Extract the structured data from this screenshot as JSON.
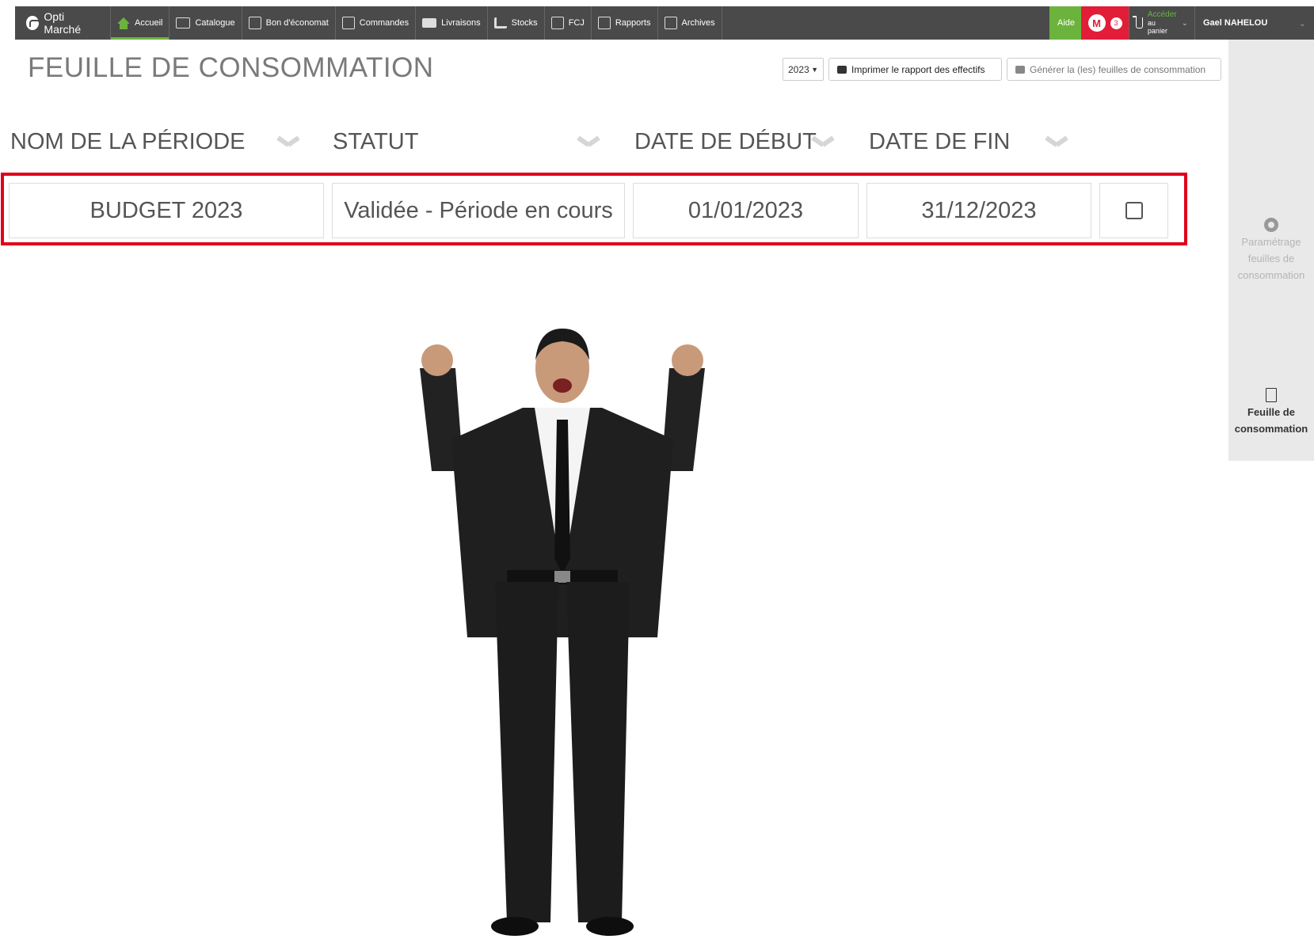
{
  "brand": "Opti Marché",
  "nav": [
    {
      "label": "Accueil",
      "icon": "home-icon",
      "active": true
    },
    {
      "label": "Catalogue",
      "icon": "book-icon"
    },
    {
      "label": "Bon d'économat",
      "icon": "document-icon"
    },
    {
      "label": "Commandes",
      "icon": "clipboard-icon"
    },
    {
      "label": "Livraisons",
      "icon": "truck-icon"
    },
    {
      "label": "Stocks",
      "icon": "forklift-icon"
    },
    {
      "label": "FCJ",
      "icon": "report-icon"
    },
    {
      "label": "Rapports",
      "icon": "chart-icon"
    },
    {
      "label": "Archives",
      "icon": "archive-icon"
    }
  ],
  "topright": {
    "aide": "Aide",
    "notif_count": "3",
    "cart_line1": "Accéder",
    "cart_line2": "au panier",
    "user": "Gael NAHELOU"
  },
  "page": {
    "title": "FEUILLE DE CONSOMMATION",
    "year": "2023",
    "print_btn": "Imprimer le rapport des effectifs",
    "generate_btn": "Générer la (les) feuilles de consommation"
  },
  "table": {
    "headers": [
      "NOM DE LA PÉRIODE",
      "STATUT",
      "DATE DE DÉBUT",
      "DATE DE FIN"
    ],
    "row": {
      "name": "BUDGET 2023",
      "status": "Validée - Période en cours",
      "start": "01/01/2023",
      "end": "31/12/2023"
    }
  },
  "side": {
    "param_l1": "Paramétrage",
    "param_l2": "feuilles de",
    "param_l3": "consommation",
    "feuille_l1": "Feuille de",
    "feuille_l2": "consommation"
  },
  "colors": {
    "topbar": "#4a4a4a",
    "accent_green": "#6cb33e",
    "accent_red": "#e11d38",
    "highlight": "#e0001a"
  }
}
